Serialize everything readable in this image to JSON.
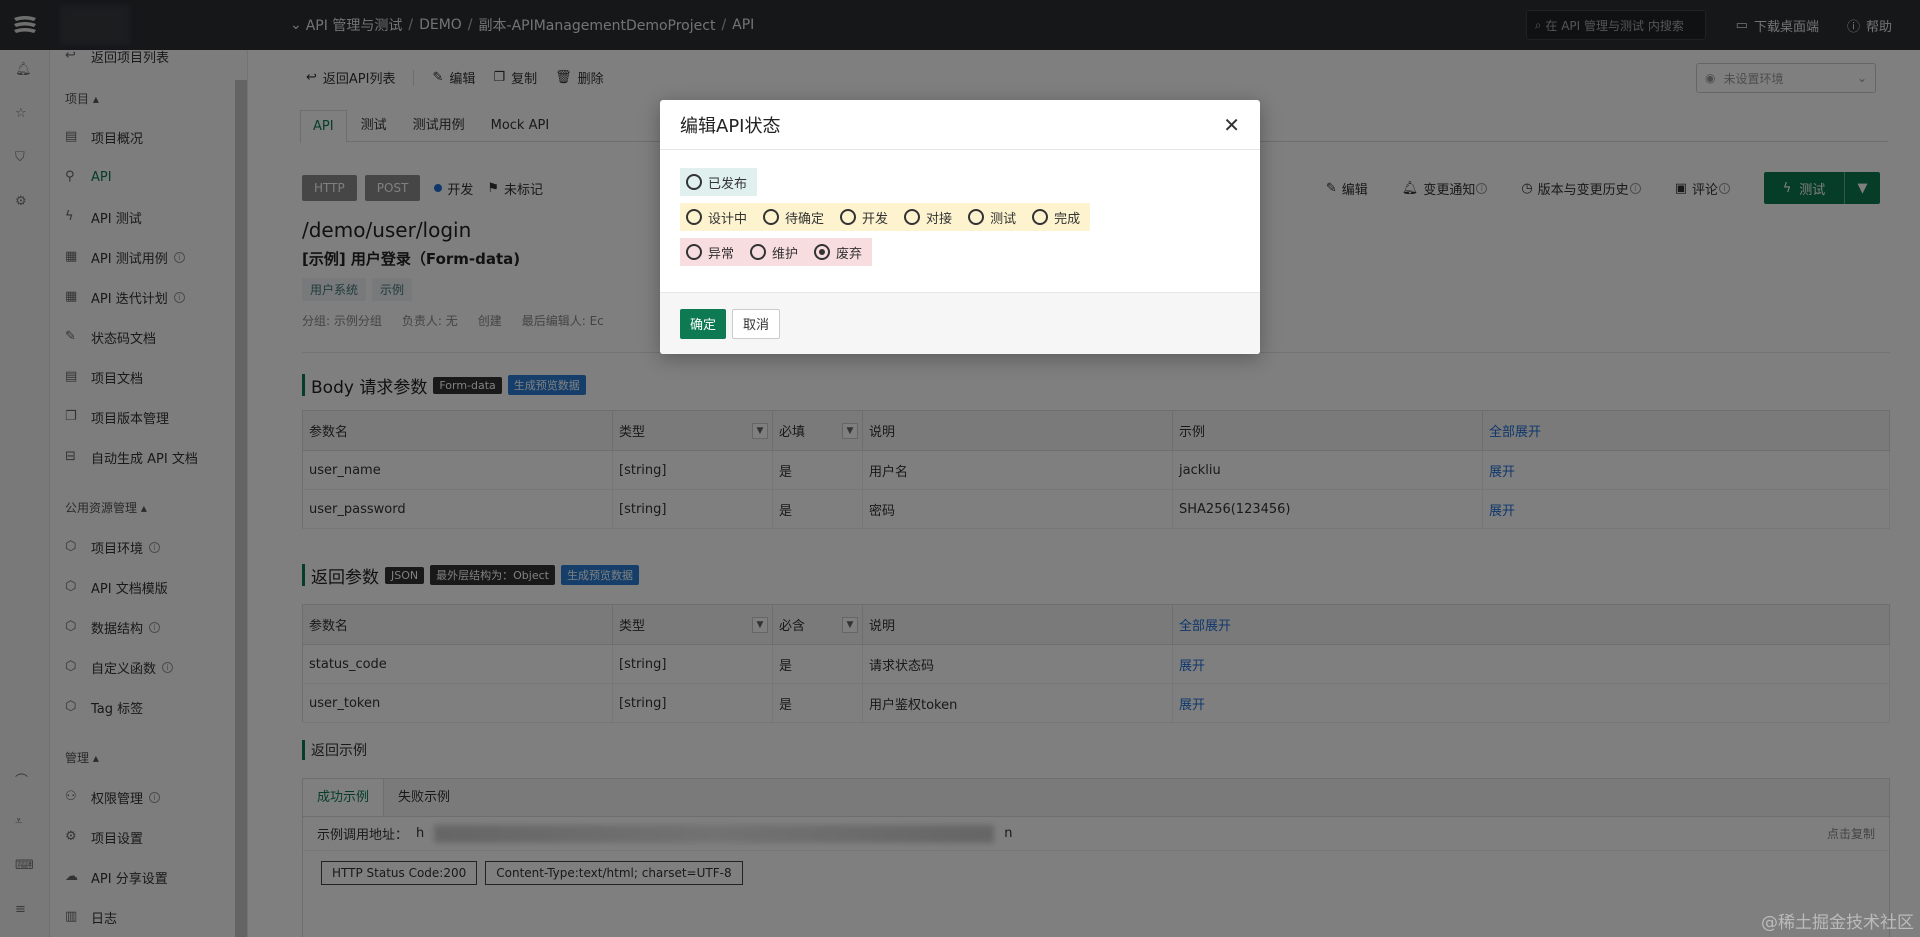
{
  "topbar": {
    "breadcrumb_root": "API 管理与测试",
    "breadcrumb_path": [
      "DEMO",
      "副本-APIManagementDemoProject",
      "API"
    ],
    "search_placeholder": "在 API 管理与测试 内搜索",
    "download_label": "下载桌面端",
    "help_label": "帮助"
  },
  "sidebar": {
    "back_label": "返回项目列表",
    "group_project": "项目 ▴",
    "items_project": [
      "项目概况",
      "API",
      "API 测试",
      "API 测试用例",
      "API 迭代计划",
      "状态码文档",
      "项目文档",
      "项目版本管理",
      "自动生成 API 文档"
    ],
    "group_public": "公用资源管理 ▴",
    "items_public": [
      "项目环境",
      "API 文档模版",
      "数据结构",
      "自定义函数",
      "Tag 标签"
    ],
    "group_manage": "管理 ▴",
    "items_manage": [
      "权限管理",
      "项目设置",
      "API 分享设置",
      "日志"
    ]
  },
  "toolbar": {
    "back": "返回API列表",
    "edit": "编辑",
    "copy": "复制",
    "delete": "删除",
    "env_placeholder": "未设置环境"
  },
  "tabs": [
    "API",
    "测试",
    "测试用例",
    "Mock API"
  ],
  "api": {
    "protocol": "HTTP",
    "method": "POST",
    "status": "开发",
    "flag": "未标记",
    "path": "/demo/user/login",
    "name": "[示例] 用户登录（Form-data)",
    "tags": [
      "用户系统",
      "示例"
    ],
    "meta": [
      "分组: 示例分组",
      "负责人: 无",
      "创建",
      "最后编辑人: Ec"
    ]
  },
  "actions": {
    "edit": "编辑",
    "notify": "变更通知",
    "history": "版本与变更历史",
    "comment": "评论",
    "test": "测试"
  },
  "body_params": {
    "title": "Body 请求参数",
    "label1": "Form-data",
    "label2": "生成预览数据",
    "headers": [
      "参数名",
      "类型",
      "必填",
      "说明",
      "示例",
      "全部展开"
    ],
    "rows": [
      [
        "user_name",
        "[string]",
        "是",
        "用户名",
        "jackliu",
        "展开"
      ],
      [
        "user_password",
        "[string]",
        "是",
        "密码",
        "SHA256(123456)",
        "展开"
      ]
    ]
  },
  "return_params": {
    "title": "返回参数",
    "label1": "JSON",
    "label2": "最外层结构为：Object",
    "label3": "生成预览数据",
    "headers": [
      "参数名",
      "类型",
      "必含",
      "说明",
      "全部展开"
    ],
    "rows": [
      [
        "status_code",
        "[string]",
        "是",
        "请求状态码",
        "展开"
      ],
      [
        "user_token",
        "[string]",
        "是",
        "用户鉴权token",
        "展开"
      ]
    ]
  },
  "return_example": {
    "title": "返回示例",
    "tabs": [
      "成功示例",
      "失败示例"
    ],
    "url_label": "示例调用地址：",
    "url_prefix": "h",
    "url_suffix": "n",
    "copy_label": "点击复制",
    "status_code": "HTTP Status Code:200",
    "content_type": "Content-Type:text/html; charset=UTF-8"
  },
  "modal": {
    "title": "编辑API状态",
    "group1": [
      "已发布"
    ],
    "group2": [
      "设计中",
      "待确定",
      "开发",
      "对接",
      "测试",
      "完成"
    ],
    "group3": [
      "异常",
      "维护",
      "废弃"
    ],
    "selected": "废弃",
    "ok": "确定",
    "cancel": "取消"
  },
  "watermark": "@稀土掘金技术社区",
  "colors": {
    "primary": "#0d7a52",
    "link": "#1e6fd9",
    "topbar": "#2b2e33"
  }
}
